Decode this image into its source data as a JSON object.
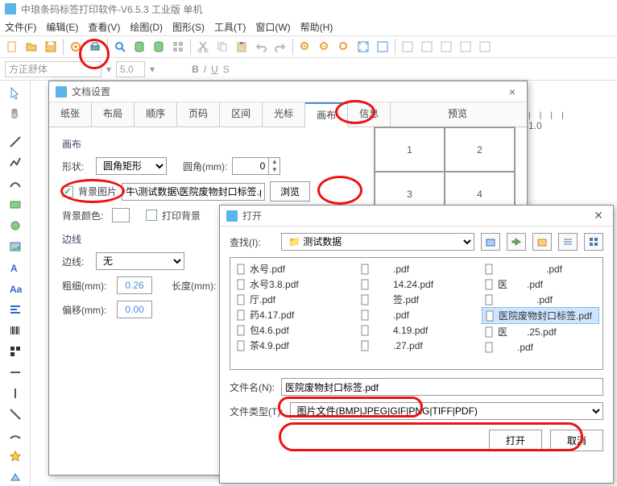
{
  "app": {
    "title": "中琅条码标签打印软件-V6.5.3 工业版 单机"
  },
  "menu": [
    "文件(F)",
    "编辑(E)",
    "查看(V)",
    "绘图(D)",
    "图形(S)",
    "工具(T)",
    "窗口(W)",
    "帮助(H)"
  ],
  "fontbar": {
    "fontname": "方正舒体",
    "fontsize": "5.0"
  },
  "docDialog": {
    "title": "文档设置",
    "tabs": [
      "纸张",
      "布局",
      "顺序",
      "页码",
      "区间",
      "光标",
      "画布",
      "信息"
    ],
    "activeTab": "画布",
    "previewLabel": "预览",
    "canvas": {
      "group": "画布",
      "shapeLabel": "形状:",
      "shapeValue": "圆角矩形",
      "roundLabel": "圆角(mm):",
      "roundValue": "0",
      "bgImgLabel": "背景图片",
      "bgImgPath": "牛\\测试数据\\医院废物封口标签.pdf",
      "browse": "浏览",
      "bgColorLabel": "背景颜色:",
      "printBgLabel": "打印背景"
    },
    "border": {
      "group": "边线",
      "borderLabel": "边线:",
      "borderValue": "无",
      "thickLabel": "粗细(mm):",
      "thickValue": "0.26",
      "lenLabel": "长度(mm):",
      "offsetLabel": "偏移(mm):",
      "offsetValue": "0.00"
    },
    "previewCells": [
      "1",
      "2",
      "3",
      "4"
    ]
  },
  "openDialog": {
    "title": "打开",
    "lookInLabel": "查找(I):",
    "lookInValue": "测试数据",
    "files": {
      "col1": [
        "水号.pdf",
        "水号3.8.pdf",
        "厅.pdf",
        "药4.17.pdf",
        "包4.6.pdf",
        "茶4.9.pdf"
      ],
      "col2": [
        "　　.pdf",
        "　　14.24.pdf",
        "　　签.pdf",
        "　　.pdf",
        "　　4.19.pdf",
        "　　.27.pdf"
      ],
      "col3": [
        "　　　　　.pdf",
        "医　　.pdf",
        "　　　　.pdf",
        "医院废物封口标签.pdf",
        "医　　.25.pdf",
        "　　.pdf"
      ]
    },
    "selectedIndex": 3,
    "fileNameLabel": "文件名(N):",
    "fileNameValue": "医院废物封口标签.pdf",
    "fileTypeLabel": "文件类型(T):",
    "fileTypeValue": "图片文件(BMP|JPEG|GIF|PNG|TIFF|PDF)",
    "openBtn": "打开",
    "cancelBtn": "取消"
  },
  "ruler": "1.0"
}
